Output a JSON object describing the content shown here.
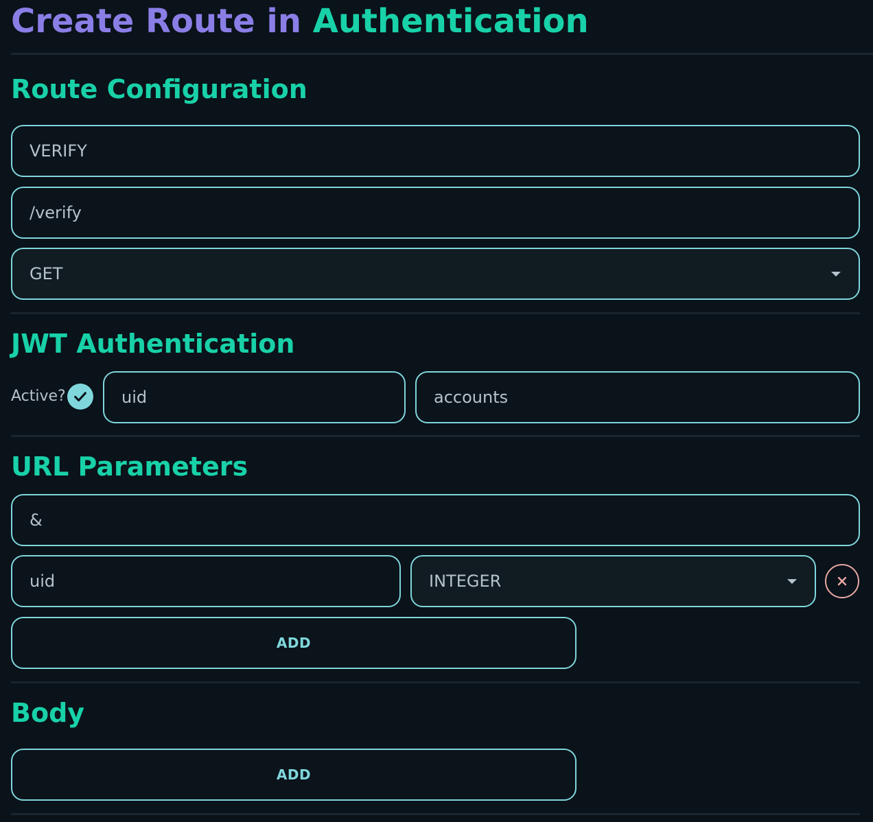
{
  "header": {
    "title_part1": "Create Route in",
    "title_part2": "Authentication"
  },
  "route_configuration": {
    "title": "Route Configuration",
    "name_value": "VERIFY",
    "path_value": "/verify",
    "method_value": "GET"
  },
  "jwt_authentication": {
    "title": "JWT Authentication",
    "active_label": "Active?",
    "active_checked": true,
    "field1_value": "uid",
    "field2_value": "accounts"
  },
  "url_parameters": {
    "title": "URL Parameters",
    "separator_value": "&",
    "params": [
      {
        "name": "uid",
        "type": "INTEGER"
      }
    ],
    "add_label": "ADD"
  },
  "body": {
    "title": "Body",
    "add_label": "ADD"
  },
  "colors": {
    "background": "#0a121a",
    "accent_teal": "#19d1a8",
    "accent_purple": "#8a7ee6",
    "border": "#7fd7dc",
    "danger": "#e9a9a3"
  },
  "icons": {
    "check": "check-circle-icon",
    "remove": "close-icon",
    "dropdown": "chevron-down-icon"
  }
}
